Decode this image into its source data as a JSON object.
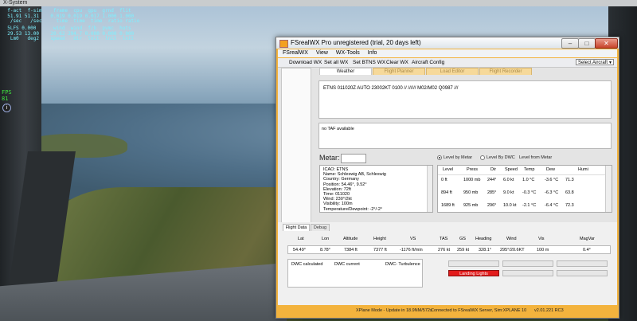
{
  "xsystem": {
    "title": "X-System",
    "overlay_rates": "  f-act  f-sim    frame  cpu  gpu  grnd  flit\n  51.91 51.31    0.019 0.019 0.017 1.000 1.000\n   /sec   /sec     time  time  time  ratio ratio",
    "overlay_speeds": "  5LFS 0.000      wind  wind  f/b  pvmc  hots\n  29.53 13.00    20.62 294.7 0.000 0.000 0.000\n   Lm0   deg2    speed   dir  lnit  lnit  lnit",
    "fps_label": "FPS\n81"
  },
  "window": {
    "title": "FSrealWX Pro unregistered (trial, 20 days left)",
    "menu": [
      "FSrealWX",
      "View",
      "WX-Tools",
      "Info"
    ],
    "toolbar": {
      "download_wx": "Download WX",
      "set_all_wx": "Set all WX",
      "set_btns_wx": "Set BTNS WX",
      "clear_wx": "Clear WX",
      "aircraft_config": "Aircraft Config",
      "select_aircraft": "Select Aircraft"
    },
    "tabs": [
      "Weather",
      "Flight Planner",
      "Load Editor",
      "Flight Recorder"
    ],
    "metar_text": "ETNS 011020Z AUTO 23002KT 0100 // ////// M02/M02 Q0987 ///",
    "taf_text": "no TAF available",
    "metar_label": "Metar:",
    "level_by_metar": "Level by Metar",
    "level_by_dwc": "Level By DWC",
    "level_from_metar": "Level from Metar",
    "station_info": [
      "ICAO: ETNS",
      "Name: Schleswig AB, Schleswig",
      "Country: Germany",
      "Position: 54.46°, 9.52°",
      "Elevation: 72ft",
      "Time: 011020",
      "Wind: 230°/2kt",
      "Visibility: 100m",
      "Temperature/Dewpoint: -2°/-2°"
    ],
    "levels": {
      "headers": [
        "Level",
        "Press",
        "Dir",
        "Speed",
        "Temp",
        "Dew",
        "Humi"
      ],
      "rows": [
        [
          "0 ft",
          "1000 mb",
          "244°",
          "6.0 kt",
          "1.0 °C",
          "-3.6 °C",
          "71.3"
        ],
        [
          "894 ft",
          "950 mb",
          "285°",
          "9.0 kt",
          "-0.3 °C",
          "-6.3 °C",
          "63.8"
        ],
        [
          "1689 ft",
          "925 mb",
          "296°",
          "10.0 kt",
          "-2.1 °C",
          "-6.4 °C",
          "72.3"
        ]
      ]
    },
    "bottom_tabs": [
      "Flight Data",
      "Debug"
    ],
    "flight_data": {
      "headers": [
        "Lat",
        "Lon",
        "Altitude",
        "Height",
        "VS",
        "TAS",
        "GS",
        "Heading",
        "Wind",
        "Vis",
        "MagVar"
      ],
      "values": [
        "54.49°",
        "8.78°",
        "7384 ft",
        "7377 ft",
        "-1176 ft/min",
        "276 kt",
        "259 kt",
        "328.1°",
        "295°/20.6KT",
        "100 m",
        "0.4°"
      ]
    },
    "dwc": {
      "calculated": "DWC calculated",
      "current": "DWC current",
      "turbulence": "DWC- Turbulence"
    },
    "landing_lights": "Landing Lights",
    "status": {
      "mode": "XPlane Mode - Update in 18.9NM/572s",
      "connection": "Connected to FSrealWX Server, Sim:XPLANE 10",
      "version": "v2.01.221 RC3"
    }
  }
}
